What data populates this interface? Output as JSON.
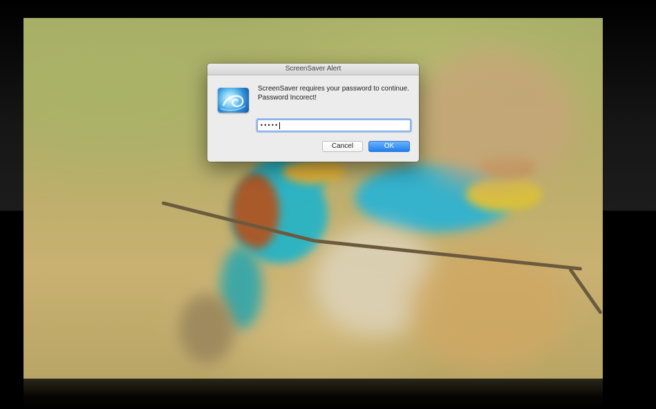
{
  "dialog": {
    "title": "ScreenSaver Alert",
    "message_line1": "ScreenSaver requires your password to continue.",
    "message_line2": "Password Incorect!",
    "password_mask": "•••••",
    "cancel_label": "Cancel",
    "ok_label": "OK",
    "accent_color": "#1f7fef"
  },
  "background": {
    "icon": "screensaver-app-icon"
  }
}
